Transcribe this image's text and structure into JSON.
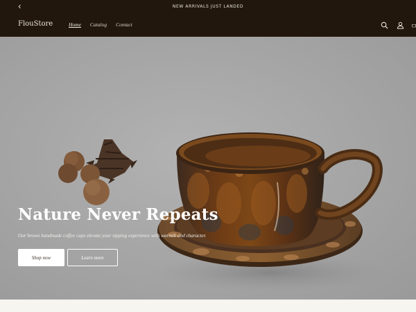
{
  "announcement": {
    "text": "NEW ARRIVALS JUST LANDED"
  },
  "header": {
    "logo": "FlouStore",
    "nav": [
      {
        "label": "Home",
        "active": true
      },
      {
        "label": "Catalog",
        "active": false
      },
      {
        "label": "Contact",
        "active": false
      }
    ],
    "icons": [
      "search-icon",
      "account-icon",
      "cart-icon"
    ]
  },
  "hero": {
    "title": "Nature Never Repeats",
    "subtitle": "Our brown handmade coffee cups elevate your sipping experience with warmth and character.",
    "primary_button": "Shop now",
    "secondary_button": "Learn more"
  },
  "colors": {
    "header_bg": "#21170d",
    "hero_bg": "#a5a5a5",
    "cup_glaze": "#5a3416",
    "text_light": "#ffffff"
  }
}
